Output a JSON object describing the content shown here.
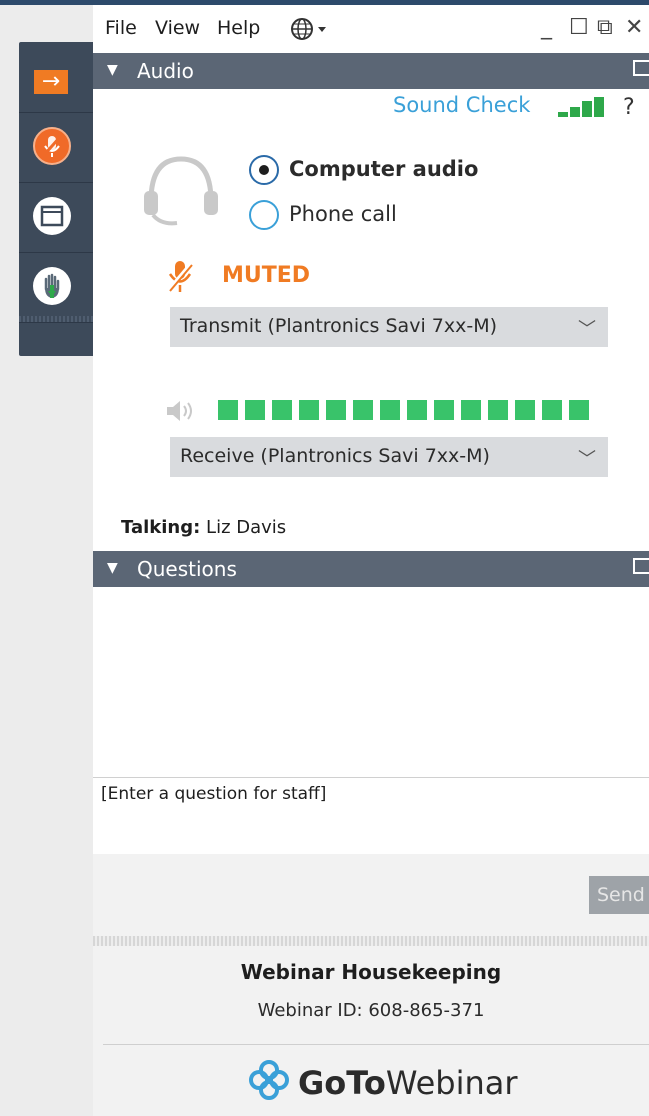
{
  "menu": {
    "file": "File",
    "view": "View",
    "help": "Help"
  },
  "window_controls": {
    "minimize": "_",
    "maximize": "☐",
    "restore": "⧉",
    "close": "✕"
  },
  "audio": {
    "section_title": "Audio",
    "sound_check": "Sound Check",
    "help": "?",
    "options": [
      {
        "label": "Computer audio",
        "selected": true
      },
      {
        "label": "Phone call",
        "selected": false
      }
    ],
    "mute_status": "MUTED",
    "transmit_device": "Transmit (Plantronics Savi 7xx-M)",
    "receive_device": "Receive (Plantronics Savi 7xx-M)",
    "speaker_level": 1.0,
    "talking_label": "Talking:",
    "talking_name": "Liz Davis"
  },
  "questions": {
    "section_title": "Questions",
    "placeholder": "[Enter a question for staff]",
    "send_label": "Send"
  },
  "footer": {
    "title": "Webinar Housekeeping",
    "webinar_id": "Webinar ID: 608-865-371",
    "brand_goto": "GoTo",
    "brand_webinar": "Webinar"
  },
  "colors": {
    "accent_orange": "#f07b23",
    "level_green": "#39c36a",
    "link_blue": "#3aa0d8",
    "section_bar": "#5b6675",
    "side_panel": "#3d4a5a"
  },
  "icons": {
    "side_panel": [
      "arrow-right-icon",
      "microphone-muted-icon",
      "window-icon",
      "raise-hand-icon"
    ],
    "language": "globe-icon",
    "audio_device": "headset-icon",
    "speaker": "speaker-icon",
    "brand": "gotowebinar-logo-icon"
  }
}
